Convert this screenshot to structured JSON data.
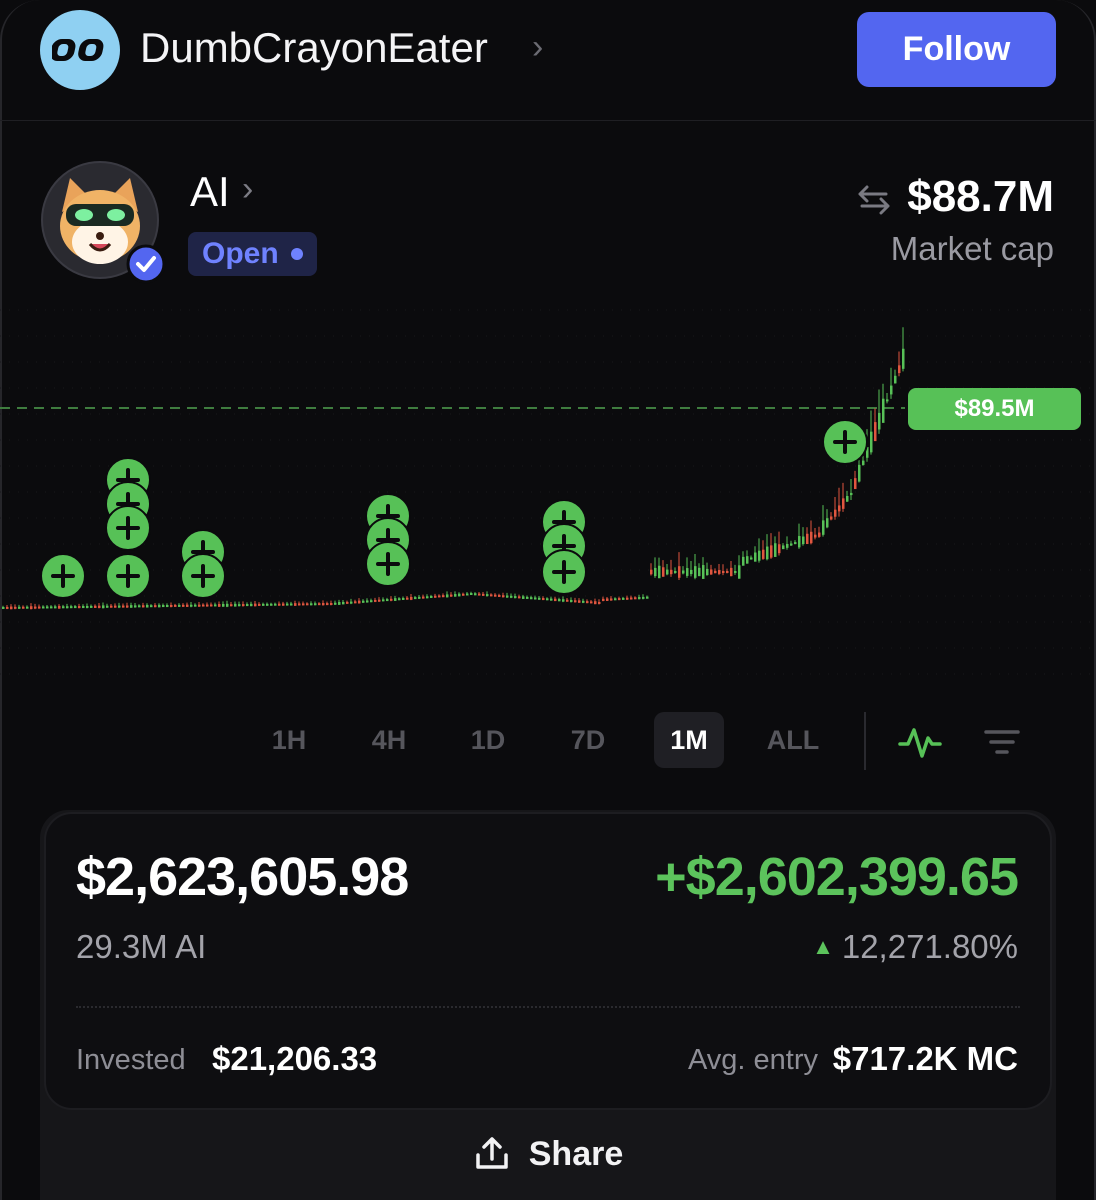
{
  "header": {
    "username": "DumbCrayonEater",
    "follow_label": "Follow",
    "avatar_icon": "infinity-logo-icon",
    "avatar_color": "#8fd0f2"
  },
  "token": {
    "name": "AI",
    "status": "Open",
    "market_cap": "$88.7M",
    "market_cap_label": "Market cap",
    "avatar_icon": "shiba-dog-avatar-icon",
    "verified_icon": "verified-badge-icon"
  },
  "chart": {
    "current_price_label": "$89.5M",
    "up_color": "#57c157",
    "down_color": "#e0563f",
    "buy_marker_icon": "plus-circle-icon"
  },
  "timeframes": {
    "items": [
      "1H",
      "4H",
      "1D",
      "7D",
      "1M",
      "ALL"
    ],
    "active": "1M"
  },
  "position": {
    "value": "$2,623,605.98",
    "pnl": "+$2,602,399.65",
    "holding": "29.3M AI",
    "pnl_percent": "12,271.80%",
    "invested_label": "Invested",
    "invested_value": "$21,206.33",
    "avg_entry_label": "Avg. entry",
    "avg_entry_value": "$717.2K MC",
    "share_label": "Share"
  },
  "colors": {
    "accent": "#5366f0",
    "positive": "#5cc35c",
    "status": "#6f82ff"
  }
}
